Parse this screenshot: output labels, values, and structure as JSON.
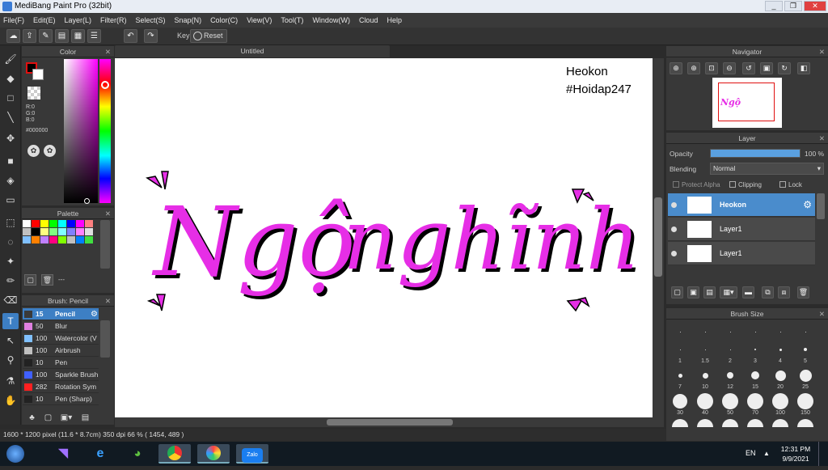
{
  "window": {
    "title": "MediBang Paint Pro (32bit)",
    "min": "_",
    "max": "❐",
    "close": "✕"
  },
  "menu": [
    "File(F)",
    "Edit(E)",
    "Layer(L)",
    "Filter(R)",
    "Select(S)",
    "Snap(N)",
    "Color(C)",
    "View(V)",
    "Tool(T)",
    "Window(W)",
    "Cloud",
    "Help"
  ],
  "toolbar": {
    "key_label": "Key",
    "reset_label": "Reset"
  },
  "color_panel": {
    "title": "Color",
    "r": "R:0",
    "g": "G:0",
    "b": "B:0",
    "hex": "#000000"
  },
  "palette_panel": {
    "title": "Palette",
    "colors": [
      "#ffffff",
      "#ff0000",
      "#ffff00",
      "#00ff00",
      "#00ffff",
      "#0000ff",
      "#ff00ff",
      "#ff8080",
      "#c0c0c0",
      "#000000",
      "#ffff80",
      "#80ff80",
      "#80ffff",
      "#8080ff",
      "#ff80ff",
      "#e0e0e0",
      "#80c0ff",
      "#ff8000",
      "#c080ff",
      "#ff0080",
      "#80ff00",
      "#c0c0c0",
      "#0080ff",
      "#40e040"
    ],
    "more": "---"
  },
  "brush_panel": {
    "title": "Brush: Pencil",
    "items": [
      {
        "size": "15",
        "name": "Pencil",
        "color": "#3a3a3a"
      },
      {
        "size": "50",
        "name": "Blur",
        "color": "#e080e0"
      },
      {
        "size": "100",
        "name": "Watercolor (V",
        "color": "#80c0ff"
      },
      {
        "size": "100",
        "name": "Airbrush",
        "color": "#c0c0c0"
      },
      {
        "size": "10",
        "name": "Pen",
        "color": "#222222"
      },
      {
        "size": "100",
        "name": "Sparkle Brush",
        "color": "#4060ff"
      },
      {
        "size": "282",
        "name": "Rotation Sym",
        "color": "#ff2020"
      },
      {
        "size": "10",
        "name": "Pen (Sharp)",
        "color": "#222222"
      }
    ]
  },
  "document": {
    "tab": "Untitled",
    "watermark_line1": "Heokon",
    "watermark_line2": "#Hoidap247",
    "art_word1": "Ngộ",
    "art_word2": "nghĩnh"
  },
  "status": "1600 * 1200 pixel   (11.6 * 8.7cm)   350 dpi   66 %   ( 1454, 489 )",
  "navigator": {
    "title": "Navigator"
  },
  "layer_panel": {
    "title": "Layer",
    "opacity_label": "Opacity",
    "opacity_value": "100 %",
    "opacity": 1.0,
    "blending_label": "Blending",
    "blending_value": "Normal",
    "protect_alpha": "Protect Alpha",
    "clipping": "Clipping",
    "lock": "Lock",
    "layers": [
      {
        "name": "Heokon",
        "selected": true
      },
      {
        "name": "Layer1",
        "selected": false
      },
      {
        "name": "Layer1",
        "selected": false
      }
    ]
  },
  "brush_size_panel": {
    "title": "Brush Size",
    "sizes": [
      "1",
      "1.5",
      "2",
      "3",
      "4",
      "5",
      "7",
      "10",
      "12",
      "15",
      "20",
      "25",
      "30",
      "40",
      "50",
      "70",
      "100",
      "150"
    ]
  },
  "taskbar": {
    "lang": "EN",
    "time": "12:31 PM",
    "date": "9/9/2021",
    "zalo": "Zalo"
  }
}
